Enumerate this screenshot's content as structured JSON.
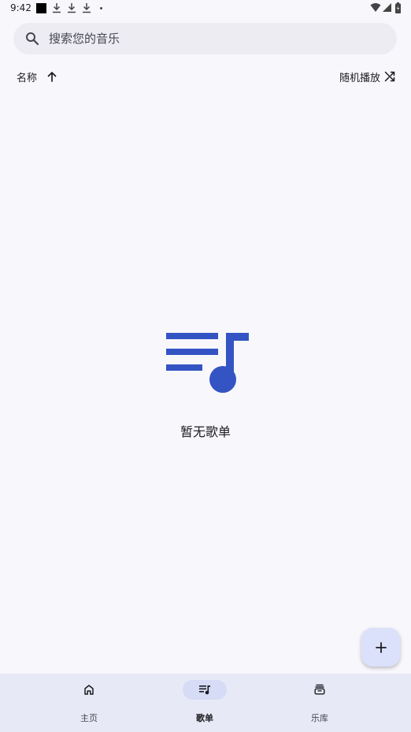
{
  "status_bar": {
    "time": "9:42",
    "left_icons": [
      "app-notification-icon",
      "download-icon",
      "download-icon",
      "download-icon",
      "more-dot-icon"
    ],
    "right_icons": [
      "wifi-icon",
      "cellular-signal-icon",
      "battery-icon"
    ]
  },
  "search": {
    "placeholder": "搜索您的音乐",
    "value": "",
    "icon": "search-icon"
  },
  "sort": {
    "label": "名称",
    "direction_icon": "arrow-up-icon"
  },
  "shuffle": {
    "label": "随机播放",
    "icon": "shuffle-icon"
  },
  "empty_state": {
    "icon": "playlist-music-icon",
    "message": "暂无歌单"
  },
  "fab": {
    "icon": "add-icon"
  },
  "bottom_nav": {
    "items": [
      {
        "label": "主页",
        "icon": "home-icon",
        "active": false
      },
      {
        "label": "歌单",
        "icon": "playlist-icon",
        "active": true
      },
      {
        "label": "乐库",
        "icon": "library-icon",
        "active": false
      }
    ]
  },
  "colors": {
    "background": "#f8f7fc",
    "accent": "#3454c4",
    "fab_background": "#dbe1fb",
    "nav_background": "#e7e9f6",
    "nav_active_indicator": "#d6dcf6",
    "search_background": "#ececf2"
  }
}
